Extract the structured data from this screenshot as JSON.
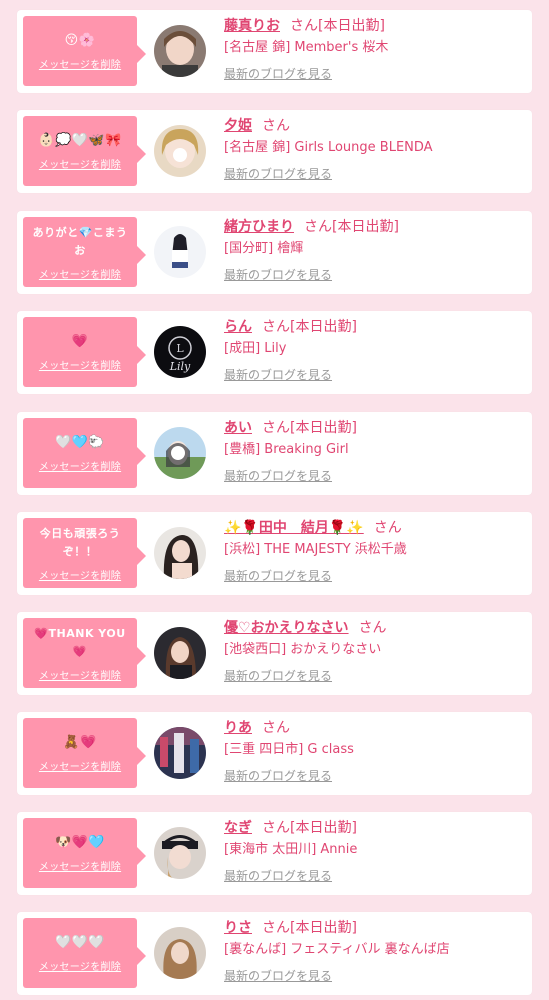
{
  "colors": {
    "background": "#fbe3ea",
    "bubble": "#ff95ad",
    "accent": "#e04672",
    "link_gray": "#999999"
  },
  "common": {
    "delete_label": "メッセージを削除",
    "blog_label": "最新のブログを見る",
    "san_label": "さん"
  },
  "cards": [
    {
      "message": "😚🌸",
      "name": "藤真りお",
      "status": "[本日出勤]",
      "shop": "[名古屋 錦] Member's 桜木"
    },
    {
      "message": "👶🏻💭🤍🦋🎀",
      "name": "夕姫",
      "status": "",
      "shop": "[名古屋 錦] Girls Lounge BLENDA"
    },
    {
      "message": "ありがと💎こまうお",
      "name": "緒方ひまり",
      "status": "[本日出勤]",
      "shop": "[国分町] 檜輝"
    },
    {
      "message": "💗",
      "name": "らん",
      "status": "[本日出勤]",
      "shop": "[成田] Lily"
    },
    {
      "message": "🤍🩵🐑",
      "name": "あい",
      "status": "[本日出勤]",
      "shop": "[豊橋] Breaking Girl"
    },
    {
      "message": "今日も頑張ろうぞ！！",
      "name": "✨🌹田中　結月🌹✨",
      "status": "",
      "shop": "[浜松] THE MAJESTY 浜松千歳"
    },
    {
      "message": "💗THANK YOU💗",
      "name": "優♡おかえりなさい",
      "status": "",
      "shop": "[池袋西口] おかえりなさい"
    },
    {
      "message": "🧸💗",
      "name": "りあ",
      "status": "",
      "shop": "[三重 四日市] G class"
    },
    {
      "message": "🐶💗🩵",
      "name": "なぎ",
      "status": "[本日出勤]",
      "shop": "[東海市 太田川] Annie"
    },
    {
      "message": "🤍🤍🤍",
      "name": "りさ",
      "status": "[本日出勤]",
      "shop": "[裏なんば] フェスティバル 裏なんば店"
    }
  ]
}
